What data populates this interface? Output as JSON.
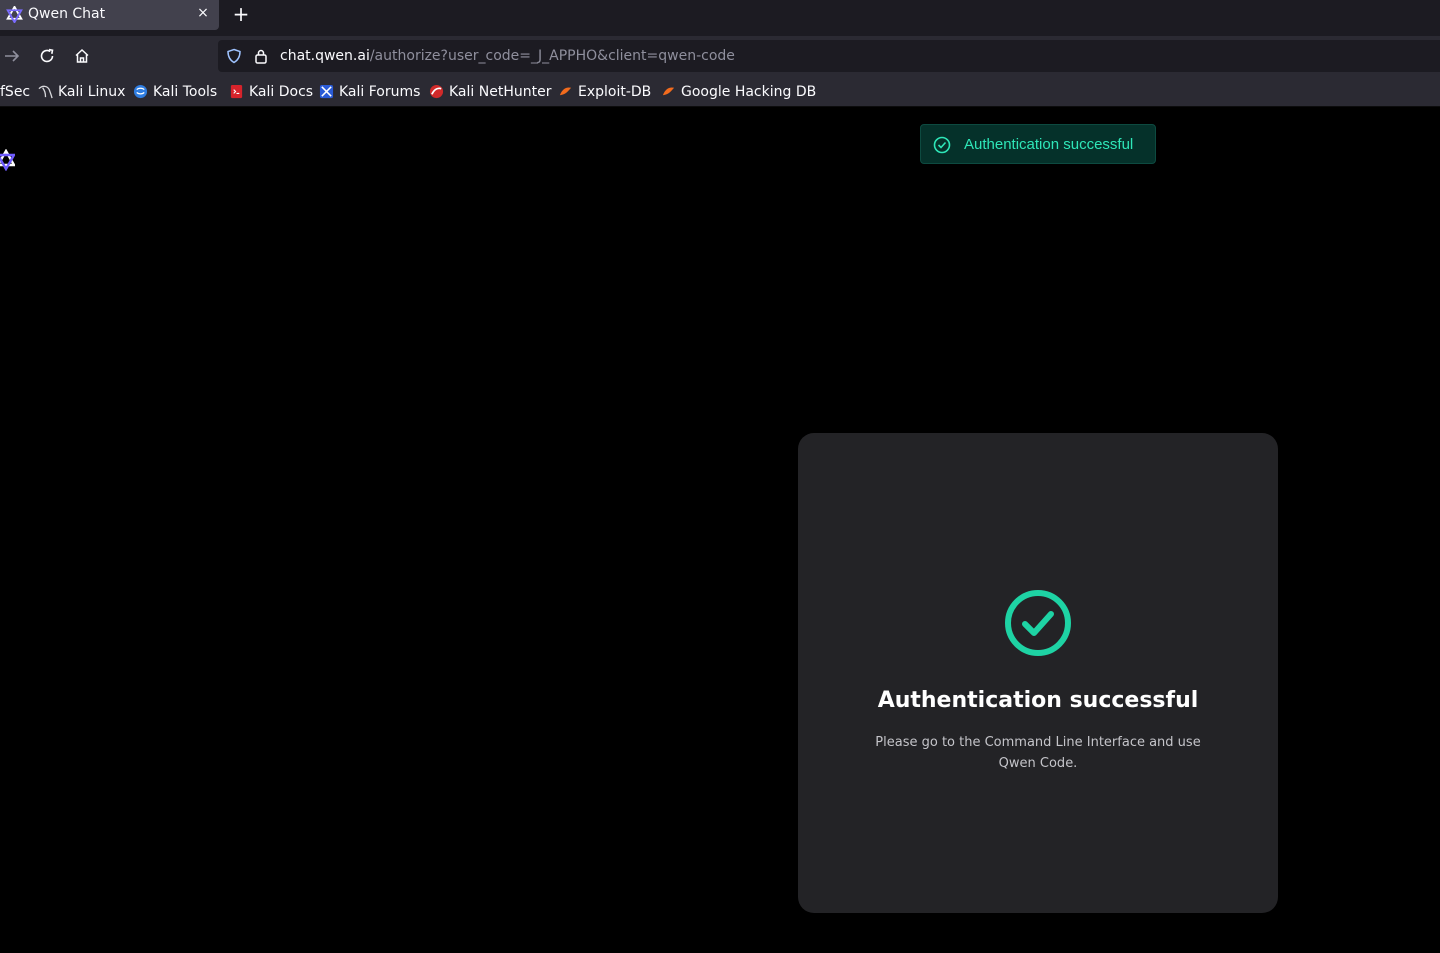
{
  "browser": {
    "tab": {
      "title": "Qwen Chat",
      "close_label": "×"
    },
    "new_tab_label": "+",
    "url": {
      "host": "chat.qwen.ai",
      "path": "/authorize?user_code=_J_APPHO&client=qwen-code"
    },
    "bookmarks": [
      {
        "label": "fSec",
        "icon": "offsec-icon"
      },
      {
        "label": "Kali Linux",
        "icon": "kali-dragon-icon"
      },
      {
        "label": "Kali Tools",
        "icon": "kali-tools-icon"
      },
      {
        "label": "Kali Docs",
        "icon": "kali-docs-icon"
      },
      {
        "label": "Kali Forums",
        "icon": "kali-forums-icon"
      },
      {
        "label": "Kali NetHunter",
        "icon": "nethunter-icon"
      },
      {
        "label": "Exploit-DB",
        "icon": "exploit-db-icon"
      },
      {
        "label": "Google Hacking DB",
        "icon": "ghdb-icon"
      }
    ]
  },
  "toast": {
    "message": "Authentication successful"
  },
  "card": {
    "title": "Authentication successful",
    "description": "Please go to the Command Line Interface and use Qwen Code."
  },
  "colors": {
    "accent_green": "#1ed3a4",
    "toast_text": "#2ee6b8",
    "qwen_purple": "#6f5cff"
  }
}
